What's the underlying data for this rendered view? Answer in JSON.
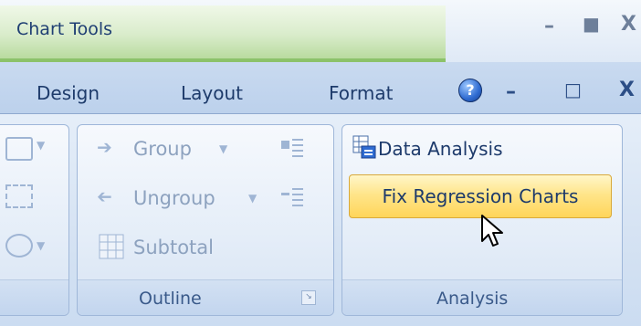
{
  "title_bar": {
    "context_label": "Chart Tools",
    "minimize_glyph": "–",
    "maximize_glyph": "■",
    "close_glyph": "X"
  },
  "tabs": [
    {
      "label": "Design"
    },
    {
      "label": "Layout"
    },
    {
      "label": "Format"
    }
  ],
  "window_controls": {
    "help_glyph": "?",
    "minimize_glyph": "–",
    "restore_glyph": "□",
    "close_glyph": "X"
  },
  "outline_group": {
    "name": "Outline",
    "group_label": "Group",
    "ungroup_label": "Ungroup",
    "subtotal_label": "Subtotal"
  },
  "analysis_group": {
    "name": "Analysis",
    "data_analysis_label": "Data Analysis",
    "fix_regression_label": "Fix Regression Charts"
  },
  "colors": {
    "contextual_tab": "#d9eccb",
    "hover_button": "#ffe58a",
    "ribbon_text": "#1d3a6b"
  }
}
